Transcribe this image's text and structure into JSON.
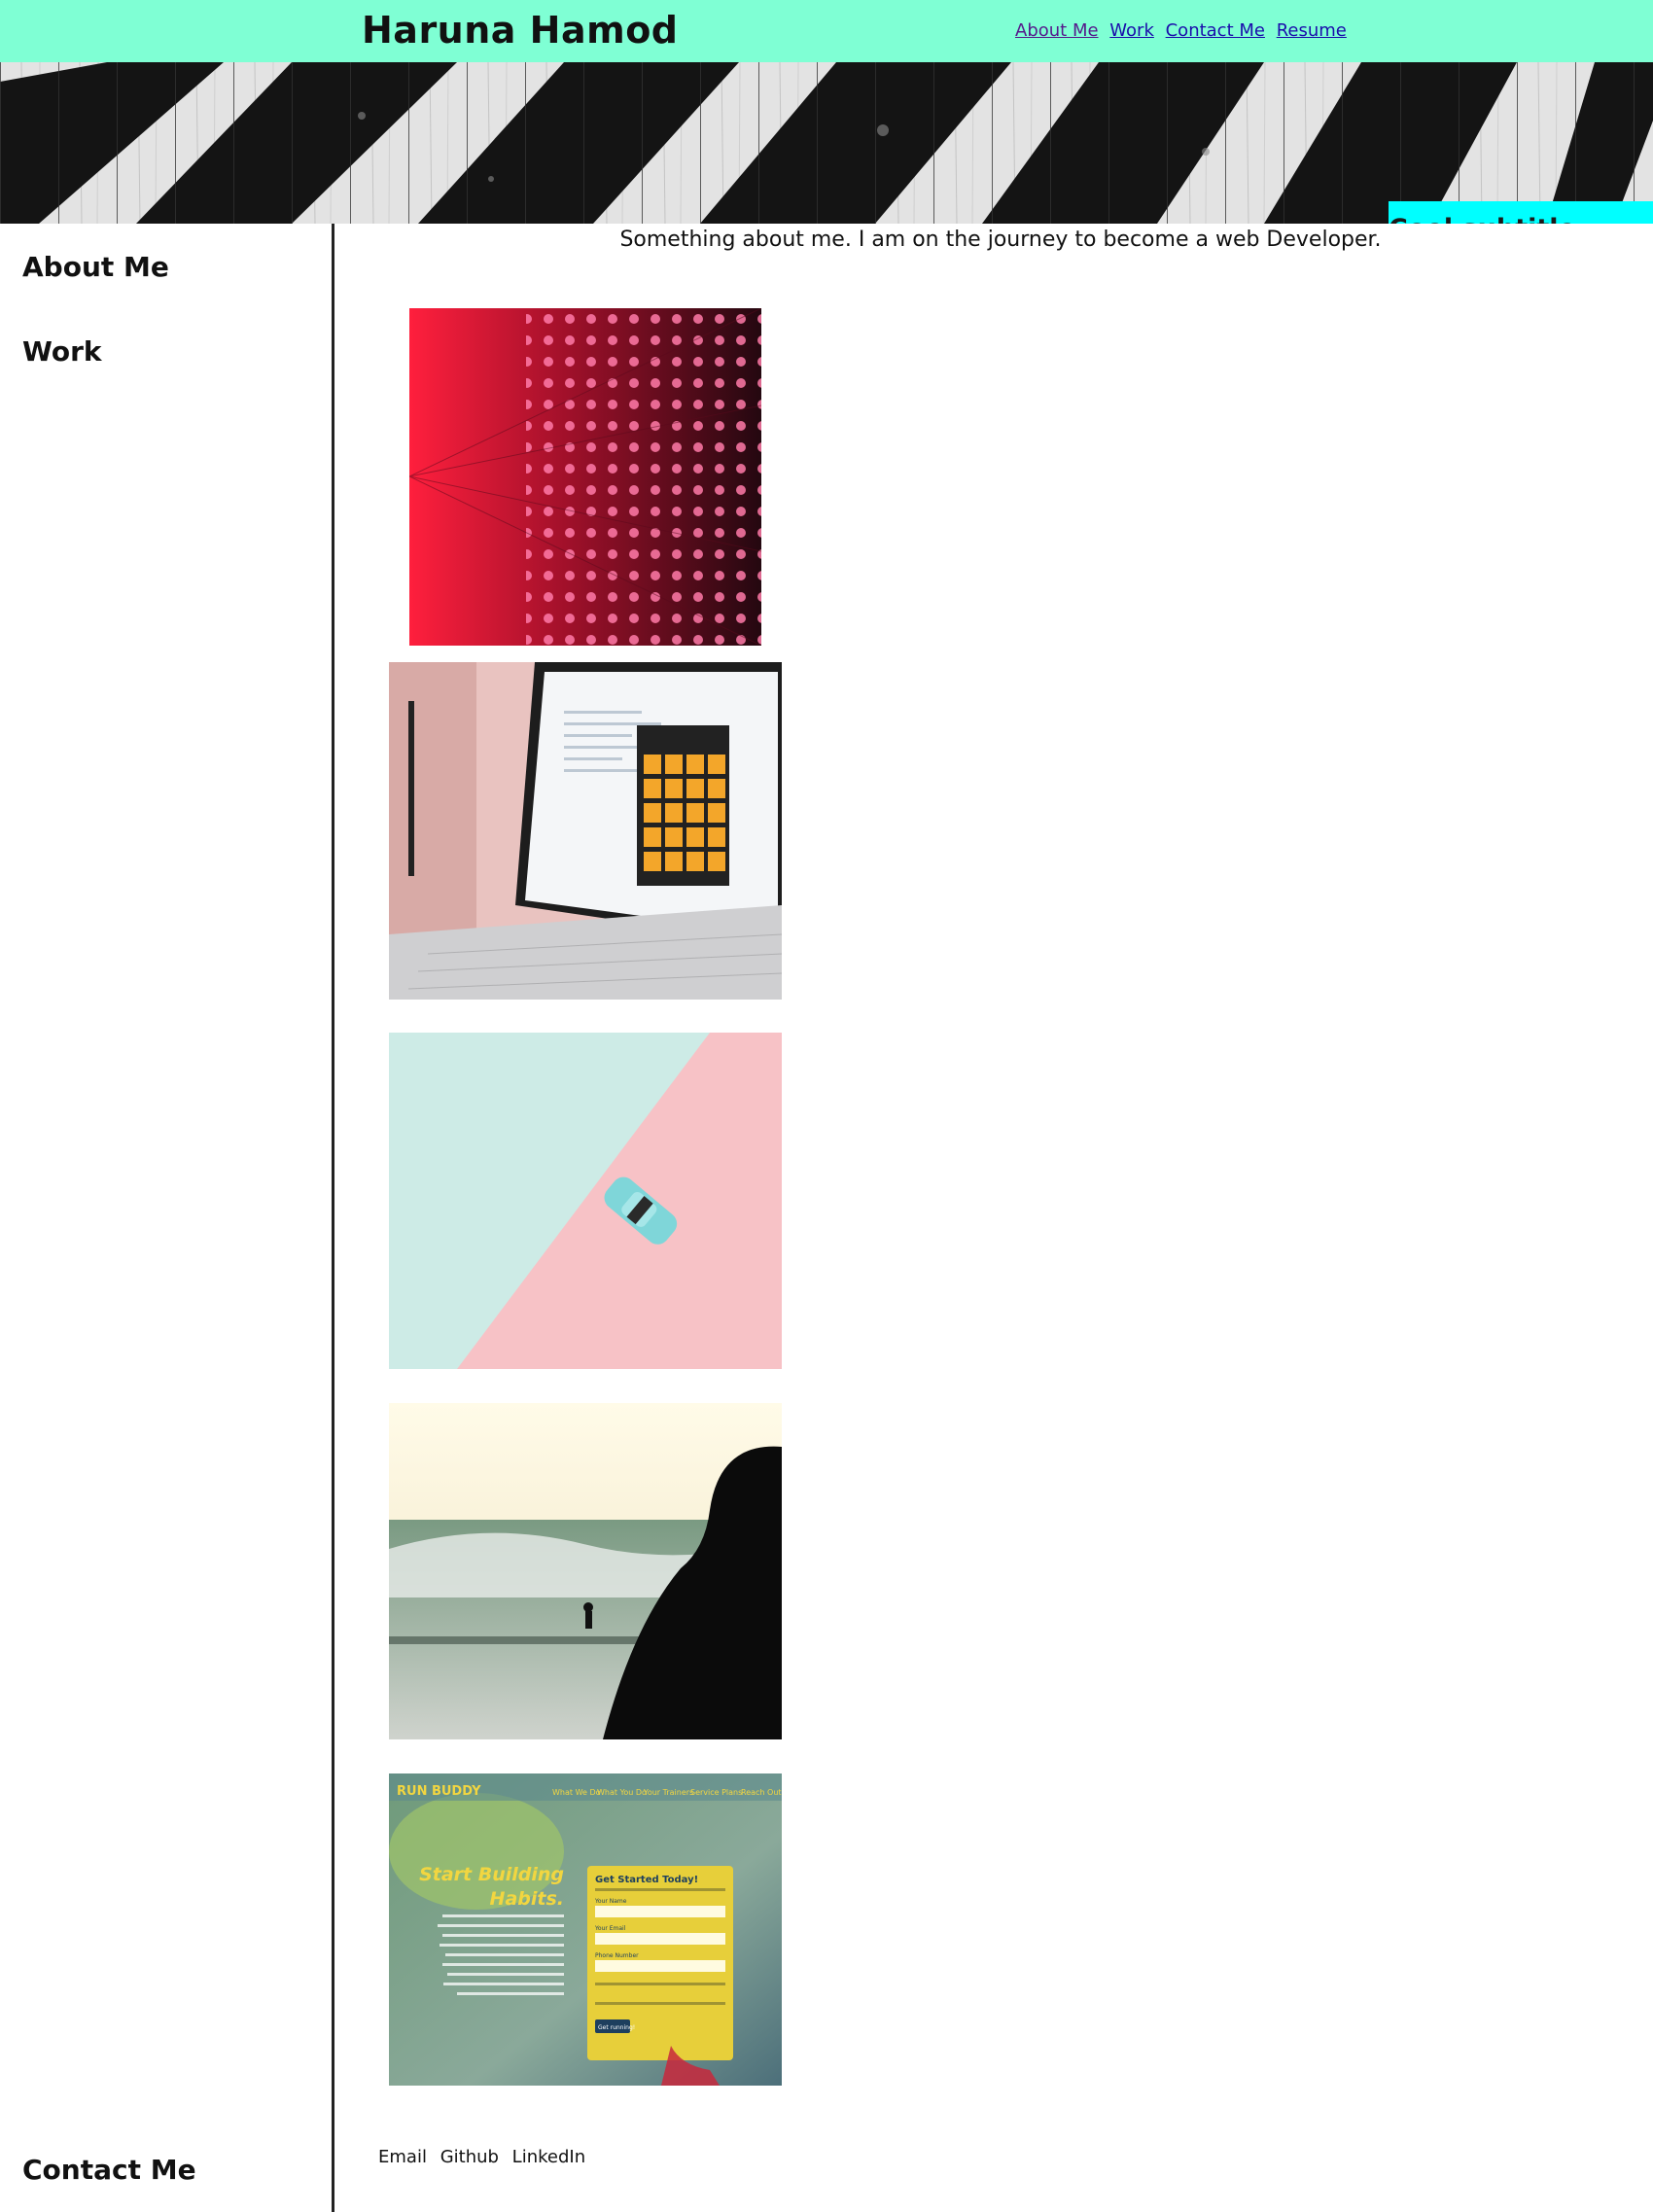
{
  "header": {
    "title": "Haruna Hamod",
    "nav": [
      {
        "label": "About Me"
      },
      {
        "label": "Work"
      },
      {
        "label": "Contact Me"
      },
      {
        "label": "Resume"
      }
    ]
  },
  "hero": {
    "subtitle": "Cool subtitle here!"
  },
  "sidebar": {
    "about": "About Me",
    "work": "Work",
    "contact": "Contact Me"
  },
  "main": {
    "intro": "Something about me. I am on the journey to become a web Developer.",
    "runbuddy": {
      "brand": "RUN BUDDY",
      "nav": [
        "What We Do",
        "What You Do",
        "Your Trainers",
        "Service Plans",
        "Reach Out"
      ],
      "heading_line1": "Start Building",
      "heading_line2": "Habits.",
      "form_title": "Get Started Today!",
      "field_name": "Your Name",
      "field_email": "Your Email",
      "field_phone": "Phone Number",
      "button": "Get running!"
    }
  },
  "footer": {
    "links": [
      "Email",
      "Github",
      "LinkedIn"
    ]
  },
  "colors": {
    "header_bg": "#7fffd4",
    "subtitle_bg": "#00ffff",
    "link": "#1a0dab",
    "visited_link": "#551a8b"
  }
}
